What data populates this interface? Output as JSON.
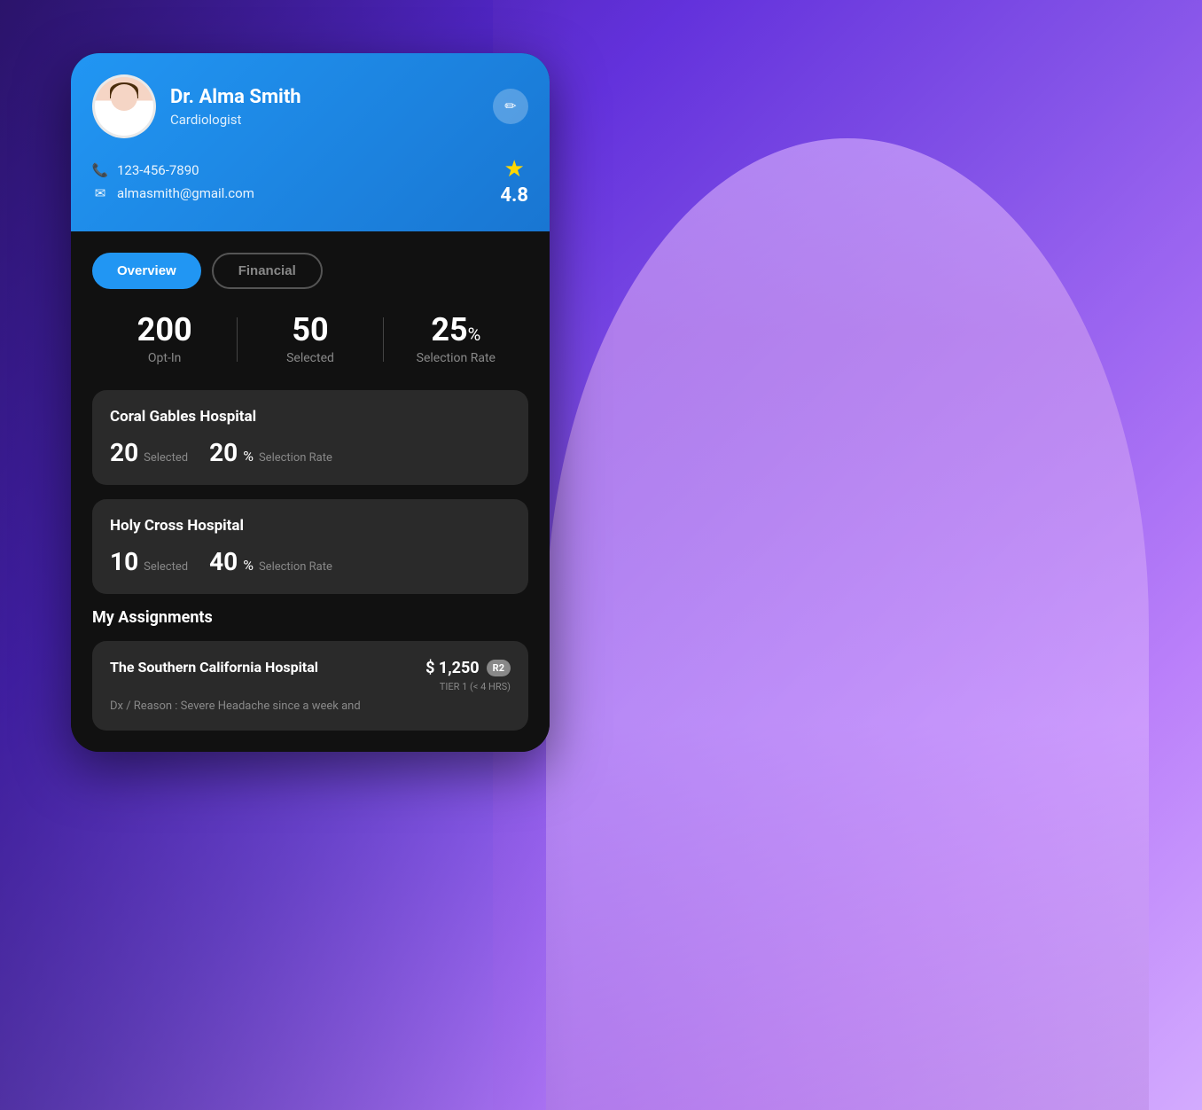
{
  "background": {
    "gradient_start": "#3a1a8a",
    "gradient_end": "#d8b4fe"
  },
  "doctor": {
    "name": "Dr. Alma Smith",
    "specialty": "Cardiologist",
    "phone": "123-456-7890",
    "email": "almasmith@gmail.com",
    "rating": "4.8"
  },
  "tabs": {
    "active": "Overview",
    "inactive": "Financial"
  },
  "stats": {
    "opt_in": "200",
    "opt_in_label": "Opt-In",
    "selected": "50",
    "selected_label": "Selected",
    "selection_rate": "25",
    "selection_rate_unit": "%",
    "selection_rate_label": "Selection Rate"
  },
  "hospitals": [
    {
      "name": "Coral Gables Hospital",
      "selected": "20",
      "selected_label": "Selected",
      "rate": "20",
      "rate_label": "Selection Rate"
    },
    {
      "name": "Holy Cross Hospital",
      "selected": "10",
      "selected_label": "Selected",
      "rate": "40",
      "rate_label": "Selection Rate"
    }
  ],
  "assignments_title": "My Assignments",
  "assignments": [
    {
      "hospital": "The Southern California Hospital",
      "amount": "$ 1,250",
      "tier_badge": "R2",
      "tier_label": "TIER 1 (< 4 HRS)",
      "description": "Dx / Reason : Severe Headache since a week and"
    }
  ],
  "icons": {
    "phone": "📞",
    "email": "✉",
    "star": "★",
    "edit": "✏"
  }
}
